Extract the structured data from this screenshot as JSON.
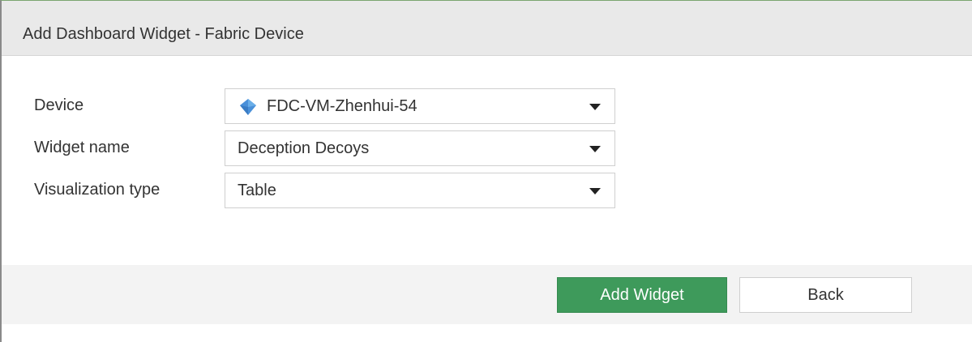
{
  "dialog": {
    "title": "Add Dashboard Widget - Fabric Device"
  },
  "form": {
    "device": {
      "label": "Device",
      "value": "FDC-VM-Zhenhui-54",
      "icon": "fortideceptor-icon",
      "icon_color": "#4a90d9"
    },
    "widget_name": {
      "label": "Widget name",
      "value": "Deception Decoys"
    },
    "visualization_type": {
      "label": "Visualization type",
      "value": "Table"
    }
  },
  "footer": {
    "add_widget_label": "Add Widget",
    "back_label": "Back",
    "primary_color": "#3e9a5b"
  }
}
